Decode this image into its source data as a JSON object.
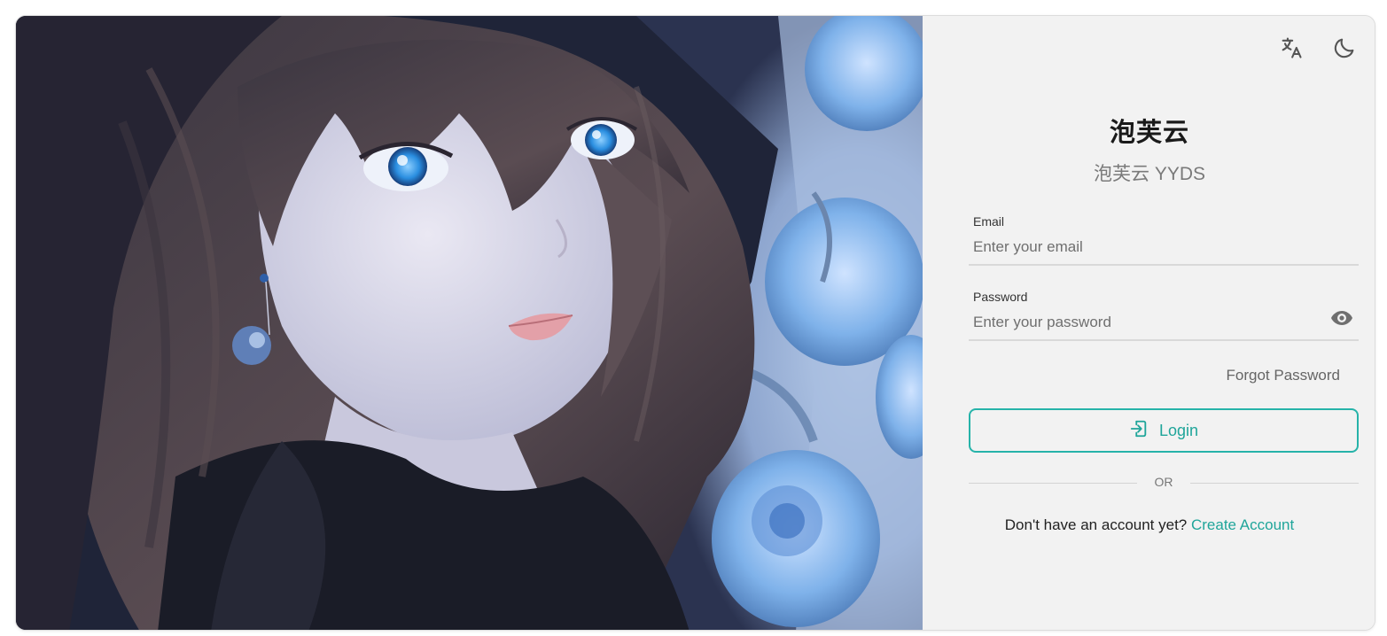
{
  "colors": {
    "accent": "#26b3a9",
    "panel_bg": "#f2f2f2",
    "muted_text": "#7a7a7a"
  },
  "header": {
    "translate_icon": "translate-icon",
    "theme_icon": "moon-icon"
  },
  "brand": {
    "title": "泡芙云",
    "subtitle": "泡芙云 YYDS"
  },
  "form": {
    "email_label": "Email",
    "email_placeholder": "Enter your email",
    "email_value": "",
    "password_label": "Password",
    "password_placeholder": "Enter your password",
    "password_value": "",
    "password_toggle_icon": "eye-icon",
    "forgot_label": "Forgot Password",
    "login_label": "Login",
    "login_icon": "login-icon"
  },
  "divider": {
    "or_label": "OR"
  },
  "signup": {
    "prompt": "Don't have an account yet?",
    "link_label": "Create Account"
  }
}
